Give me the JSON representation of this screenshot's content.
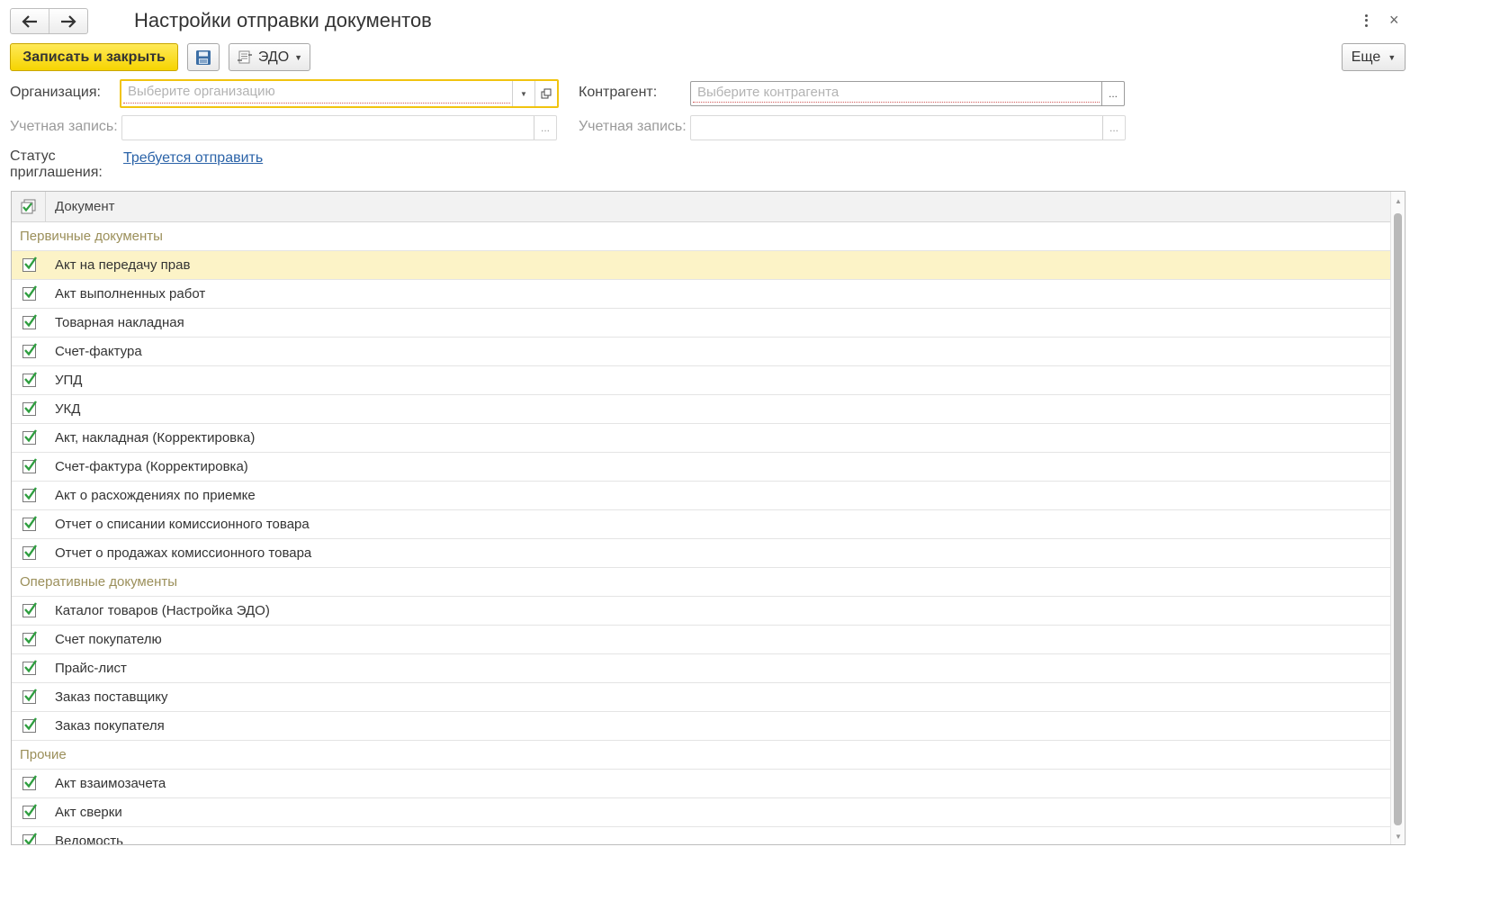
{
  "window": {
    "title": "Настройки отправки документов",
    "back_icon": "arrow-left-icon",
    "forward_icon": "arrow-right-icon",
    "menu_icon": "more-vertical-icon",
    "close_label": "×"
  },
  "toolbar": {
    "primary_label": "Записать и закрыть",
    "save_icon": "floppy-disk-icon",
    "edo_label": "ЭДО",
    "more_label": "Еще"
  },
  "form": {
    "organization": {
      "label": "Организация:",
      "placeholder": "Выберите организацию",
      "value": ""
    },
    "org_account": {
      "label": "Учетная запись:",
      "value": ""
    },
    "contractor": {
      "label": "Контрагент:",
      "placeholder": "Выберите контрагента",
      "value": ""
    },
    "contractor_account": {
      "label": "Учетная запись:",
      "value": ""
    },
    "invite_status": {
      "label_line1": "Статус",
      "label_line2": "приглашения:",
      "value": "Требуется отправить"
    },
    "dots": "..."
  },
  "table": {
    "column_header": "Документ",
    "group1": {
      "label": "Первичные документы"
    },
    "group2": {
      "label": "Оперативные документы"
    },
    "group3": {
      "label": "Прочие"
    },
    "rows": [
      "Акт на передачу прав",
      "Акт выполненных работ",
      "Товарная накладная",
      "Счет-фактура",
      "УПД",
      "УКД",
      "Акт, накладная (Корректировка)",
      "Счет-фактура (Корректировка)",
      "Акт о расхождениях по приемке",
      "Отчет о списании комиссионного товара",
      "Отчет о продажах комиссионного товара",
      "Каталог товаров (Настройка ЭДО)",
      "Счет покупателю",
      "Прайс-лист",
      "Заказ поставщику",
      "Заказ покупателя",
      "Акт взаимозачета",
      "Акт сверки",
      "Ведомость"
    ]
  },
  "colors": {
    "accent_yellow": "#f6d400",
    "selected_row": "#fcf3c7",
    "check_green": "#2e9e3f",
    "group_text": "#9b8f5a",
    "link_blue": "#2b63a8"
  }
}
